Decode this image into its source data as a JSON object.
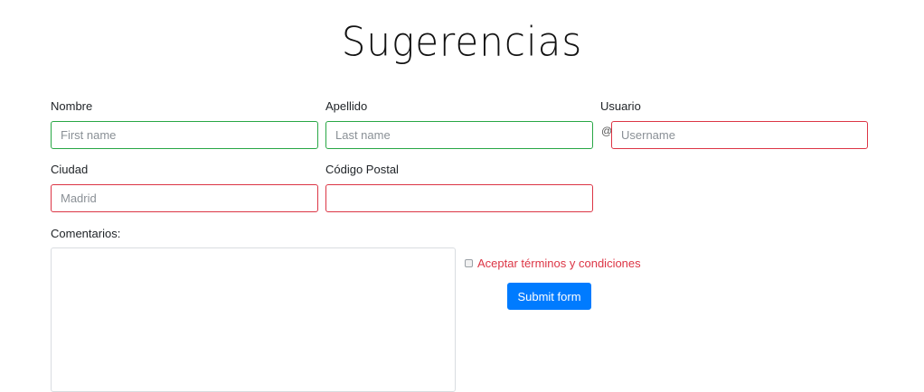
{
  "page": {
    "title": "Sugerencias"
  },
  "form": {
    "nombre": {
      "label": "Nombre",
      "placeholder": "First name",
      "value": "",
      "state": "valid"
    },
    "apellido": {
      "label": "Apellido",
      "placeholder": "Last name",
      "value": "",
      "state": "valid"
    },
    "usuario": {
      "label": "Usuario",
      "prefix": "@",
      "placeholder": "Username",
      "value": "",
      "state": "invalid"
    },
    "ciudad": {
      "label": "Ciudad",
      "placeholder": "Madrid",
      "value": "",
      "state": "invalid"
    },
    "codigo_postal": {
      "label": "Código Postal",
      "placeholder": "",
      "value": "",
      "state": "invalid"
    },
    "comentarios": {
      "label": "Comentarios:",
      "value": ""
    },
    "terms": {
      "label": "Aceptar términos y condiciones",
      "checked": false
    },
    "submit_label": "Submit form"
  },
  "colors": {
    "valid": "#28a745",
    "invalid": "#dc3545",
    "primary": "#007bff"
  }
}
